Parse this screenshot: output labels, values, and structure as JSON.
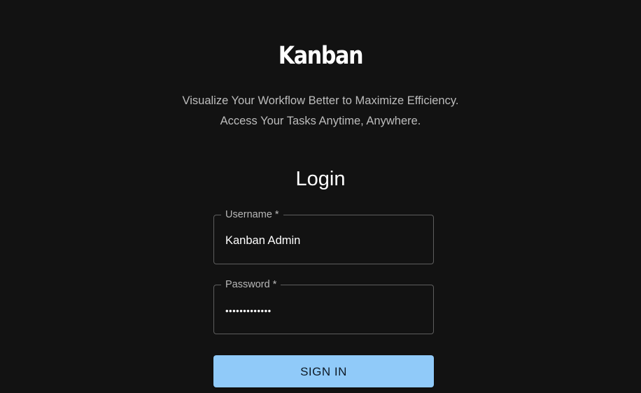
{
  "brand": {
    "title": "Kanban"
  },
  "tagline": {
    "line1": "Visualize Your Workflow Better to Maximize Efficiency.",
    "line2": "Access Your Tasks Anytime, Anywhere."
  },
  "login": {
    "heading": "Login",
    "username": {
      "label": "Username *",
      "value": "Kanban Admin"
    },
    "password": {
      "label": "Password *",
      "value": "•••••••••••••"
    },
    "submit_label": "SIGN IN"
  },
  "colors": {
    "background": "#121212",
    "primary_button": "#90caf9",
    "field_border": "#5e5e5e",
    "muted_text": "#bdbdbd"
  }
}
